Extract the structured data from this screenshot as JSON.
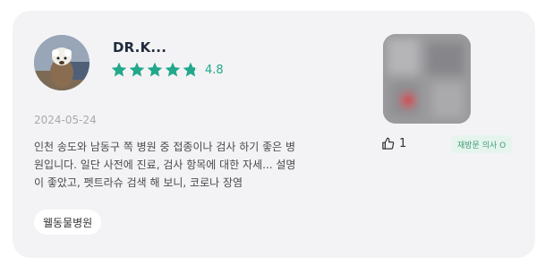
{
  "review": {
    "reviewer_name": "DR.K...",
    "rating": 4.8,
    "rating_display": "4.8",
    "stars": 5,
    "date": "2024-05-24",
    "text": "인천 송도와 남동구 쪽 병원 중 접종이나 검사 하기 좋은 병원입니다. 일단 사전에 진료, 검사 항목에 대한 자세... 설명이 좋았고, 펫트라슈 검색 해 보니, 코로나 장염",
    "hospital": "웰동물병원",
    "likes": "1",
    "badge": "재방문 의사 O"
  },
  "colors": {
    "star": "#22a88a",
    "card_bg": "#f3f3f5",
    "badge_bg": "#e6f4ee",
    "badge_text": "#3d9c73"
  },
  "icons": {
    "rating": "star-icon",
    "likes": "thumbs-up-icon"
  }
}
